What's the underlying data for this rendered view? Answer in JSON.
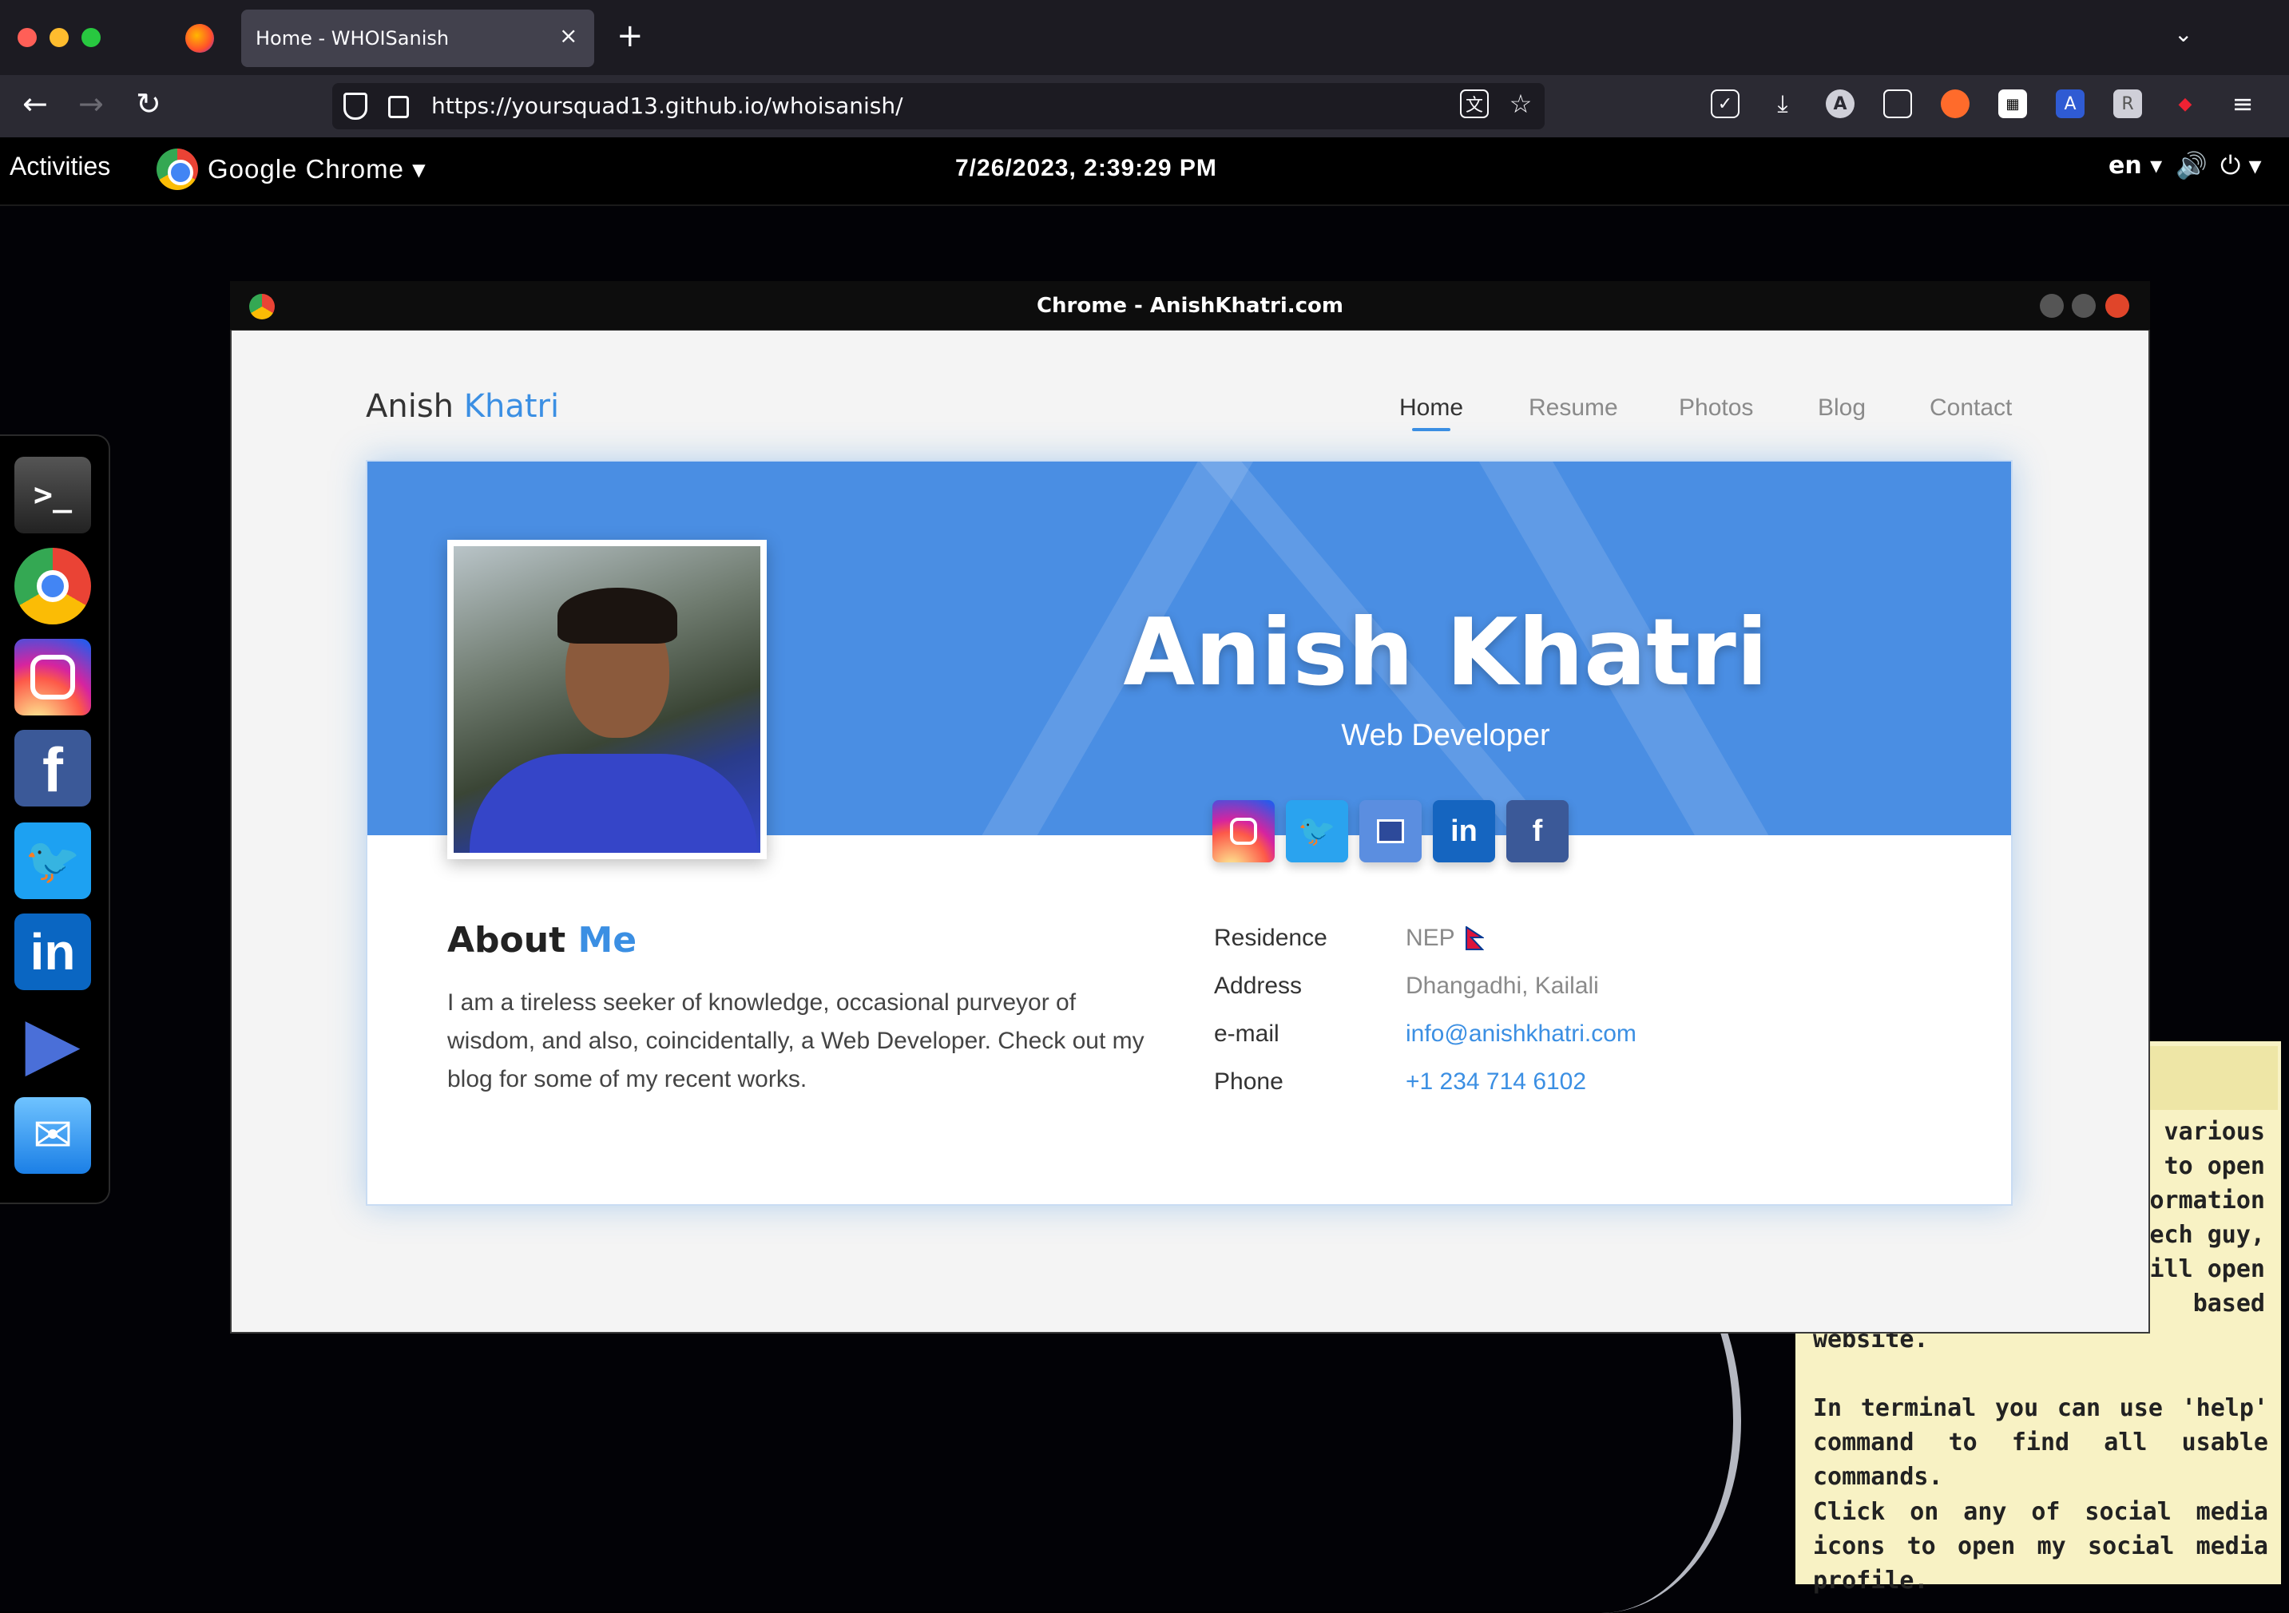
{
  "browser": {
    "tab_title": "Home - WHOISanish",
    "tab_close": "×",
    "new_tab": "+",
    "tab_list": "⌄",
    "back": "←",
    "forward": "→",
    "reload": "↻",
    "url": "https://yoursquad13.github.io/whoisanish/"
  },
  "gnome": {
    "activities": "Activities",
    "app_menu": "Google Chrome ▾",
    "clock": "7/26/2023, 2:39:29 PM",
    "lang": "en ▾",
    "volume": "🔊",
    "power": "⏻ ▾"
  },
  "dock": {
    "items": [
      "terminal",
      "chrome",
      "instagram",
      "facebook",
      "twitter",
      "linkedin",
      "resume",
      "mail"
    ]
  },
  "sticky": {
    "partial_lines": [
      "e various",
      "to open",
      "ormation",
      "ech guy,",
      "ill open",
      "based"
    ],
    "line7": "website.",
    "para2": "In terminal you can use 'help' command to find all usable commands.",
    "para3": "Click on any of social media icons to open my social media profile."
  },
  "window": {
    "title": "Chrome - AnishKhatri.com"
  },
  "site": {
    "brand_first": "Anish",
    "brand_last": "Khatri",
    "menu": [
      "Home",
      "Resume",
      "Photos",
      "Blog",
      "Contact"
    ],
    "name": "Anish Khatri",
    "role": "Web Developer",
    "about_title_a": "About",
    "about_title_b": "Me",
    "about_text": "I am a tireless seeker of knowledge, occasional purveyor of wisdom, and also, coincidentally, a Web Developer. Check out my blog for some of my recent works.",
    "info": {
      "residence_label": "Residence",
      "residence_value": "NEP",
      "address_label": "Address",
      "address_value": "Dhangadhi, Kailali",
      "email_label": "e-mail",
      "email_value": "info@anishkhatri.com",
      "phone_label": "Phone",
      "phone_value": "+1 234 714 6102"
    },
    "social": [
      "instagram",
      "twitter",
      "resume",
      "linkedin",
      "facebook"
    ]
  },
  "colors": {
    "accent": "#3b8fe3",
    "banner": "#4a8ee3",
    "sticky": "#f8f2c4"
  }
}
